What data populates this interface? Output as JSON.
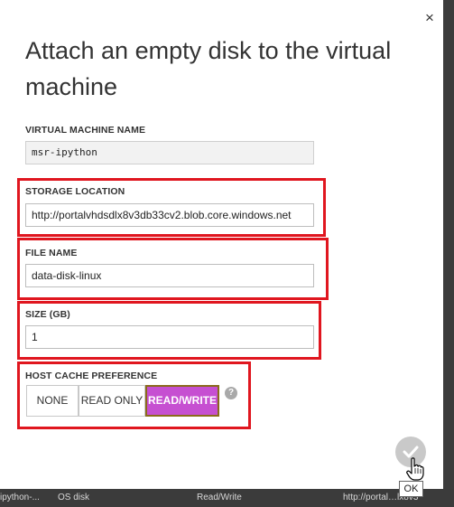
{
  "dialog": {
    "title": "Attach an empty disk to the virtual machine",
    "close_glyph": "×"
  },
  "fields": {
    "vm_name": {
      "label": "VIRTUAL MACHINE NAME",
      "value": "msr-ipython"
    },
    "storage_location": {
      "label": "STORAGE LOCATION",
      "value": "http://portalvhdsdlx8v3db33cv2.blob.core.windows.net"
    },
    "file_name": {
      "label": "FILE NAME",
      "value": "data-disk-linux"
    },
    "size": {
      "label": "SIZE (GB)",
      "value": "1"
    }
  },
  "host_cache": {
    "label": "HOST CACHE PREFERENCE",
    "options": [
      "NONE",
      "READ ONLY",
      "READ/WRITE"
    ],
    "selected": "READ/WRITE",
    "help_glyph": "?"
  },
  "ok_tooltip": "OK",
  "background_row": {
    "col1": "ipython-...",
    "col2": "OS disk",
    "col3": "Read/Write",
    "col4": "http://portal…lx8v3"
  },
  "colors": {
    "highlight_border": "#e0161f",
    "selected_option": "#c64fd1"
  },
  "icons": {
    "close": "close-icon",
    "ok": "checkmark-icon",
    "help": "help-icon",
    "cursor": "hand-pointer-icon"
  }
}
